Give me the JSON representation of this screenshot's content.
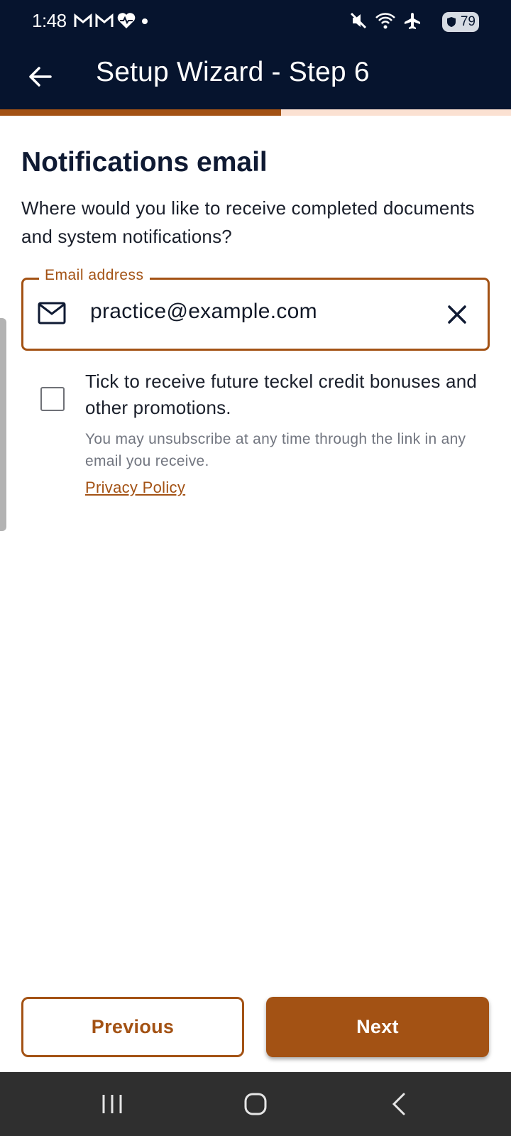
{
  "status_bar": {
    "time": "1:48",
    "left_icons": [
      "gmail-icon",
      "gmail-icon",
      "health-icon",
      "dot-icon"
    ],
    "right_icons": [
      "mute-icon",
      "wifi-icon",
      "airplane-icon"
    ],
    "battery": "79"
  },
  "app_bar": {
    "title": "Setup Wizard - Step 6",
    "back_icon": "arrow-left-icon"
  },
  "progress": {
    "value": 0.55,
    "fill_color": "#a35214",
    "track_color": "#fbe1d2"
  },
  "main": {
    "title": "Notifications email",
    "description": "Where would you like to receive completed documents and system notifications?",
    "email_field": {
      "label": "Email address",
      "value": "practice@example.com",
      "leading_icon": "mail-icon",
      "trailing_icon": "close-icon"
    },
    "promotions": {
      "checked": false,
      "label": "Tick to receive future teckel credit bonuses and other promotions.",
      "note": "You may unsubscribe at any time through the link in any email you receive.",
      "privacy_link": "Privacy Policy"
    }
  },
  "buttons": {
    "previous": "Previous",
    "next": "Next"
  },
  "colors": {
    "header_bg": "#06142e",
    "accent": "#a35214",
    "nav_bg": "#2f2f2f"
  },
  "nav_bar": {
    "items": [
      "recent-apps-icon",
      "home-icon",
      "back-icon"
    ]
  }
}
